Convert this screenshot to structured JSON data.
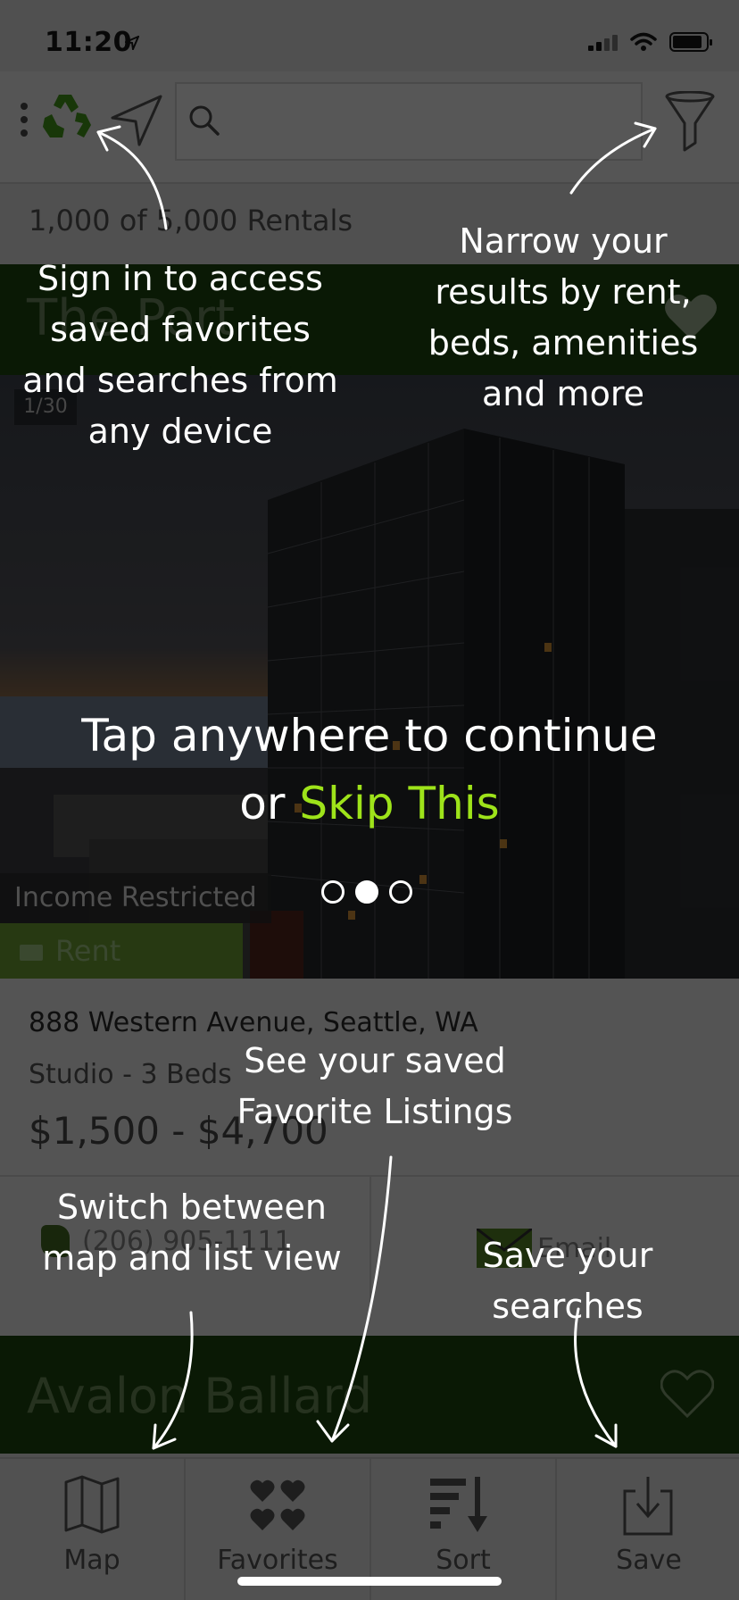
{
  "status_bar": {
    "time": "11:20"
  },
  "header": {
    "search": {
      "placeholder": ""
    }
  },
  "results": {
    "count_text": "1,000 of 5,000 Rentals"
  },
  "listing1": {
    "name": "The Port",
    "photo_counter": "1/30",
    "badge_income": "Income Restricted",
    "badge_specials": "Rent Specials",
    "address": "888 Western Avenue, Seattle, WA",
    "beds": "Studio - 3 Beds",
    "price": "$1,500 - $4,700",
    "phone": "(206) 905-1111",
    "email_label": "Email"
  },
  "listing2": {
    "name": "Avalon Ballard"
  },
  "tabs": [
    {
      "label": "Map",
      "icon": "map-icon"
    },
    {
      "label": "Favorites",
      "icon": "hearts-icon"
    },
    {
      "label": "Sort",
      "icon": "sort-icon"
    },
    {
      "label": "Save",
      "icon": "save-icon"
    }
  ],
  "tutorial": {
    "signin_tip": "Sign in to access saved favorites and searches from any device",
    "narrow_tip": "Narrow your results by rent, beds, amenities and more",
    "continue_line1": "Tap anywhere to continue",
    "continue_or": "or ",
    "skip_label": "Skip This",
    "favorites_tip": "See your saved Favorite Listings",
    "switch_tip": "Switch between map and list view",
    "save_tip": "Save your searches",
    "page_index": 2,
    "page_count": 3
  },
  "colors": {
    "brand_green": "#14300b",
    "skip_green": "#9ee31a",
    "overlay": "rgba(0,0,0,0.48)"
  }
}
